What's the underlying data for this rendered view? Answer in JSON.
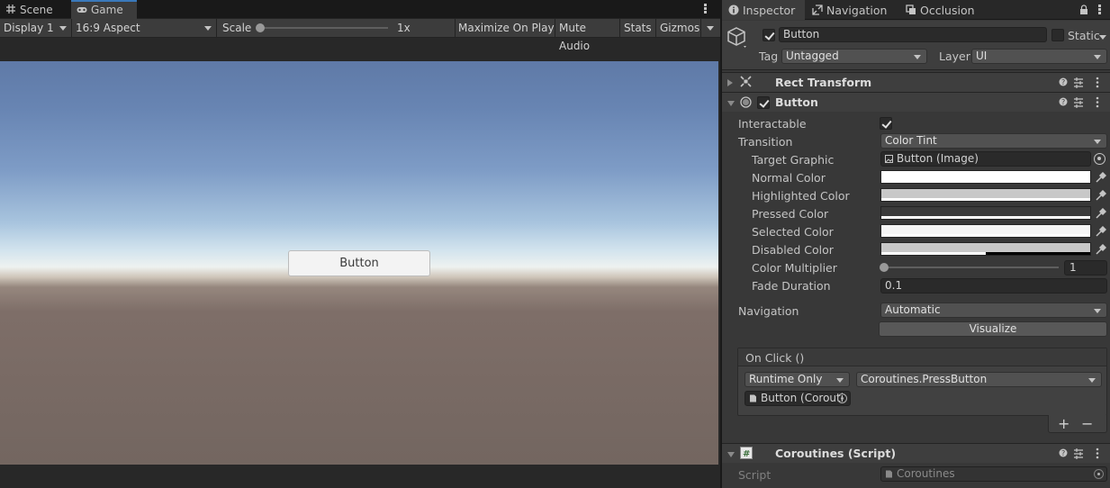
{
  "game_panel": {
    "tabs": [
      {
        "label": "Scene",
        "icon": "grid-icon"
      },
      {
        "label": "Game",
        "icon": "gamepad-icon"
      }
    ],
    "toolbar": {
      "display": "Display 1",
      "aspect": "16:9 Aspect",
      "scale_label": "Scale",
      "scale_value": "1x",
      "maximize_on_play": "Maximize On Play",
      "mute_audio": "Mute Audio",
      "stats": "Stats",
      "gizmos": "Gizmos"
    },
    "scene_button_label": "Button"
  },
  "inspector": {
    "tabs": [
      {
        "label": "Inspector",
        "icon": "info-icon"
      },
      {
        "label": "Navigation",
        "icon": "navigation-icon"
      },
      {
        "label": "Occlusion",
        "icon": "occlusion-icon"
      }
    ],
    "header": {
      "active": true,
      "object_name": "Button",
      "static_label": "Static",
      "tag_label": "Tag",
      "tag_value": "Untagged",
      "layer_label": "Layer",
      "layer_value": "UI"
    },
    "rect_transform": {
      "title": "Rect Transform"
    },
    "button_component": {
      "title": "Button",
      "enabled": true,
      "interactable_label": "Interactable",
      "interactable": true,
      "transition_label": "Transition",
      "transition_value": "Color Tint",
      "target_graphic_label": "Target Graphic",
      "target_graphic_value": "Button (Image)",
      "normal_color_label": "Normal Color",
      "normal_color": "#ffffff",
      "highlighted_color_label": "Highlighted Color",
      "highlighted_color": "#f5f5f5",
      "pressed_color_label": "Pressed Color",
      "pressed_color": "#c8c8c8",
      "selected_color_label": "Selected Color",
      "selected_color": "#f5f5f5",
      "disabled_color_label": "Disabled Color",
      "disabled_color": "#c8c8c8",
      "color_multiplier_label": "Color Multiplier",
      "color_multiplier_value": "1",
      "fade_duration_label": "Fade Duration",
      "fade_duration_value": "0.1",
      "navigation_label": "Navigation",
      "navigation_value": "Automatic",
      "visualize_label": "Visualize",
      "onclick_label": "On Click ()",
      "onclick_mode": "Runtime Only",
      "onclick_function": "Coroutines.PressButton",
      "onclick_target": "Button (Corouti",
      "add_label": "+",
      "remove_label": "−"
    },
    "coroutines_component": {
      "title": "Coroutines (Script)",
      "script_label": "Script",
      "script_value": "Coroutines"
    }
  }
}
